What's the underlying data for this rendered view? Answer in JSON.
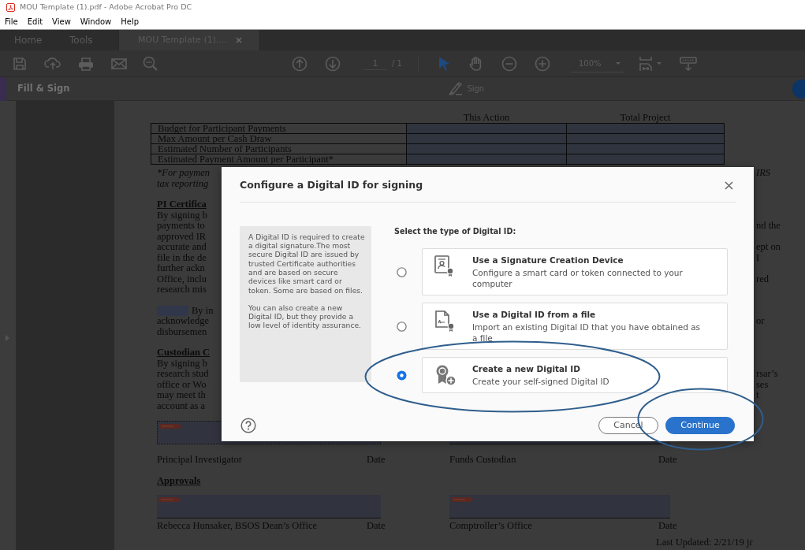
{
  "title_bar": {
    "title": "MOU Template (1).pdf - Adobe Acrobat Pro DC"
  },
  "menu": [
    "File",
    "Edit",
    "View",
    "Window",
    "Help"
  ],
  "tabs": [
    {
      "label": "Home",
      "selected": false,
      "closable": false
    },
    {
      "label": "Tools",
      "selected": false,
      "closable": false
    },
    {
      "label": "MOU Template (1)....",
      "selected": true,
      "closable": true
    }
  ],
  "toolbar": {
    "page": "1",
    "page_total": "/ 1",
    "zoom": "100%"
  },
  "fill_sign_bar": {
    "title": "Fill & Sign",
    "sign": "Sign"
  },
  "document": {
    "table": {
      "columns": [
        "This Action",
        "Total Project"
      ],
      "rows": [
        "Budget for Participant Payments",
        "Max Amount per Cash Draw",
        "Estimated Number of Participants",
        "Estimated Payment Amount per Participant*"
      ]
    },
    "blocks": [
      {
        "kind": "note",
        "left": "*For paymen",
        "right": "IRS"
      },
      {
        "kind": "note",
        "left": "tax reporting"
      },
      {
        "kind": "heading",
        "left": "PI Certifica"
      },
      {
        "kind": "line",
        "left": "By signing b"
      },
      {
        "kind": "line",
        "left": "payments to",
        "right": "nd the"
      },
      {
        "kind": "line",
        "left": "approved IR"
      },
      {
        "kind": "line",
        "left": "accurate and",
        "right": "ept on"
      },
      {
        "kind": "line",
        "left": "file in the de",
        "right": "I"
      },
      {
        "kind": "line",
        "left": "further ackn"
      },
      {
        "kind": "line",
        "left": "Office, inclu",
        "right": "red"
      },
      {
        "kind": "line",
        "left": "research mis"
      },
      {
        "kind": "field",
        "left": "By in"
      },
      {
        "kind": "line",
        "left": "acknowledge",
        "right": "or"
      },
      {
        "kind": "line",
        "left": "disbursemen"
      },
      {
        "kind": "heading",
        "left": "Custodian C"
      },
      {
        "kind": "line",
        "left": "By signing b"
      },
      {
        "kind": "line",
        "left": "research stud",
        "right": "rsar’s"
      },
      {
        "kind": "line",
        "left": "office or Wo",
        "right": "ses"
      },
      {
        "kind": "line",
        "left": "may meet th",
        "right": "t"
      },
      {
        "kind": "line",
        "left": "account as a"
      }
    ],
    "signature_rows": [
      {
        "left": {
          "label": "Principal Investigator",
          "date": "Date"
        },
        "right": {
          "label": "Funds Custodian",
          "date": "Date"
        }
      }
    ],
    "approvals_heading": "Approvals",
    "approval_rows": [
      {
        "left": {
          "label": "Rebecca Hunsaker, BSOS Dean’s Office",
          "date": "Date"
        },
        "right": {
          "label": "Comptroller’s Office",
          "date": "Date"
        }
      }
    ],
    "footer": "Last Updated: 2/21/19 jr"
  },
  "dialog": {
    "title": "Configure a Digital ID for signing",
    "info": [
      "A Digital ID is required to create a digital signature.The most secure Digital ID are issued by trusted Certificate authorities and are based on secure devices like smart card or token. Some are based on files.",
      "You can also create a new Digital ID, but they provide a low level of identity assurance."
    ],
    "prompt": "Select the type of Digital ID:",
    "options": [
      {
        "kind": "device",
        "title": "Use a Signature Creation Device",
        "description": "Configure a smart card or token connected to your computer",
        "selected": false
      },
      {
        "kind": "file",
        "title": "Use a Digital ID from a file",
        "description": "Import an existing Digital ID that you have obtained as a file",
        "selected": false
      },
      {
        "kind": "new",
        "title": "Create a new Digital ID",
        "description": "Create your self-signed Digital ID",
        "selected": true
      }
    ],
    "buttons": {
      "cancel": "Cancel",
      "continue": "Continue"
    }
  }
}
